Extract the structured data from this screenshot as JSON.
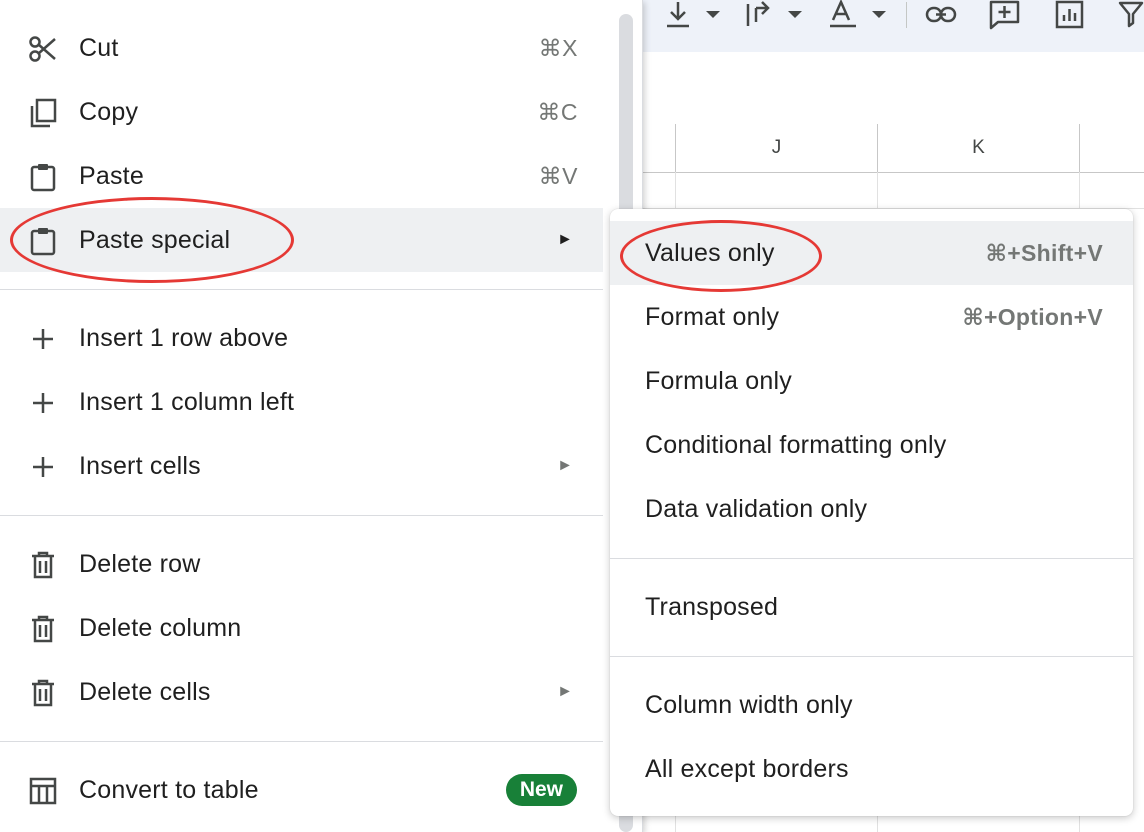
{
  "spreadsheet": {
    "column_headers": [
      "J",
      "K"
    ]
  },
  "toolbar": {
    "icons": [
      "vertical-align-icon",
      "text-wrap-icon",
      "text-color-icon",
      "link-icon",
      "add-comment-icon",
      "insert-chart-icon",
      "filter-icon"
    ]
  },
  "context_menu": {
    "items": [
      {
        "label": "Cut",
        "shortcut": "⌘X",
        "icon": "scissors-icon"
      },
      {
        "label": "Copy",
        "shortcut": "⌘C",
        "icon": "copy-icon"
      },
      {
        "label": "Paste",
        "shortcut": "⌘V",
        "icon": "clipboard-icon"
      },
      {
        "label": "Paste special",
        "icon": "clipboard-icon",
        "has_submenu": true,
        "highlighted": true
      },
      {
        "label": "Insert 1 row above",
        "icon": "plus-icon"
      },
      {
        "label": "Insert 1 column left",
        "icon": "plus-icon"
      },
      {
        "label": "Insert cells",
        "icon": "plus-icon",
        "has_submenu": true
      },
      {
        "label": "Delete row",
        "icon": "trash-icon"
      },
      {
        "label": "Delete column",
        "icon": "trash-icon"
      },
      {
        "label": "Delete cells",
        "icon": "trash-icon",
        "has_submenu": true
      },
      {
        "label": "Convert to table",
        "icon": "table-icon",
        "badge": "New"
      }
    ],
    "submenu_arrow": "►"
  },
  "paste_special_submenu": {
    "items": [
      {
        "label": "Values only",
        "shortcut": "⌘+Shift+V",
        "highlighted": true
      },
      {
        "label": "Format only",
        "shortcut": "⌘+Option+V"
      },
      {
        "label": "Formula only"
      },
      {
        "label": "Conditional formatting only"
      },
      {
        "label": "Data validation only"
      },
      {
        "label": "Transposed"
      },
      {
        "label": "Column width only"
      },
      {
        "label": "All except borders"
      }
    ]
  },
  "colors": {
    "highlight": "#eef0f2",
    "annotation": "#e53935",
    "badge": "#188038"
  }
}
